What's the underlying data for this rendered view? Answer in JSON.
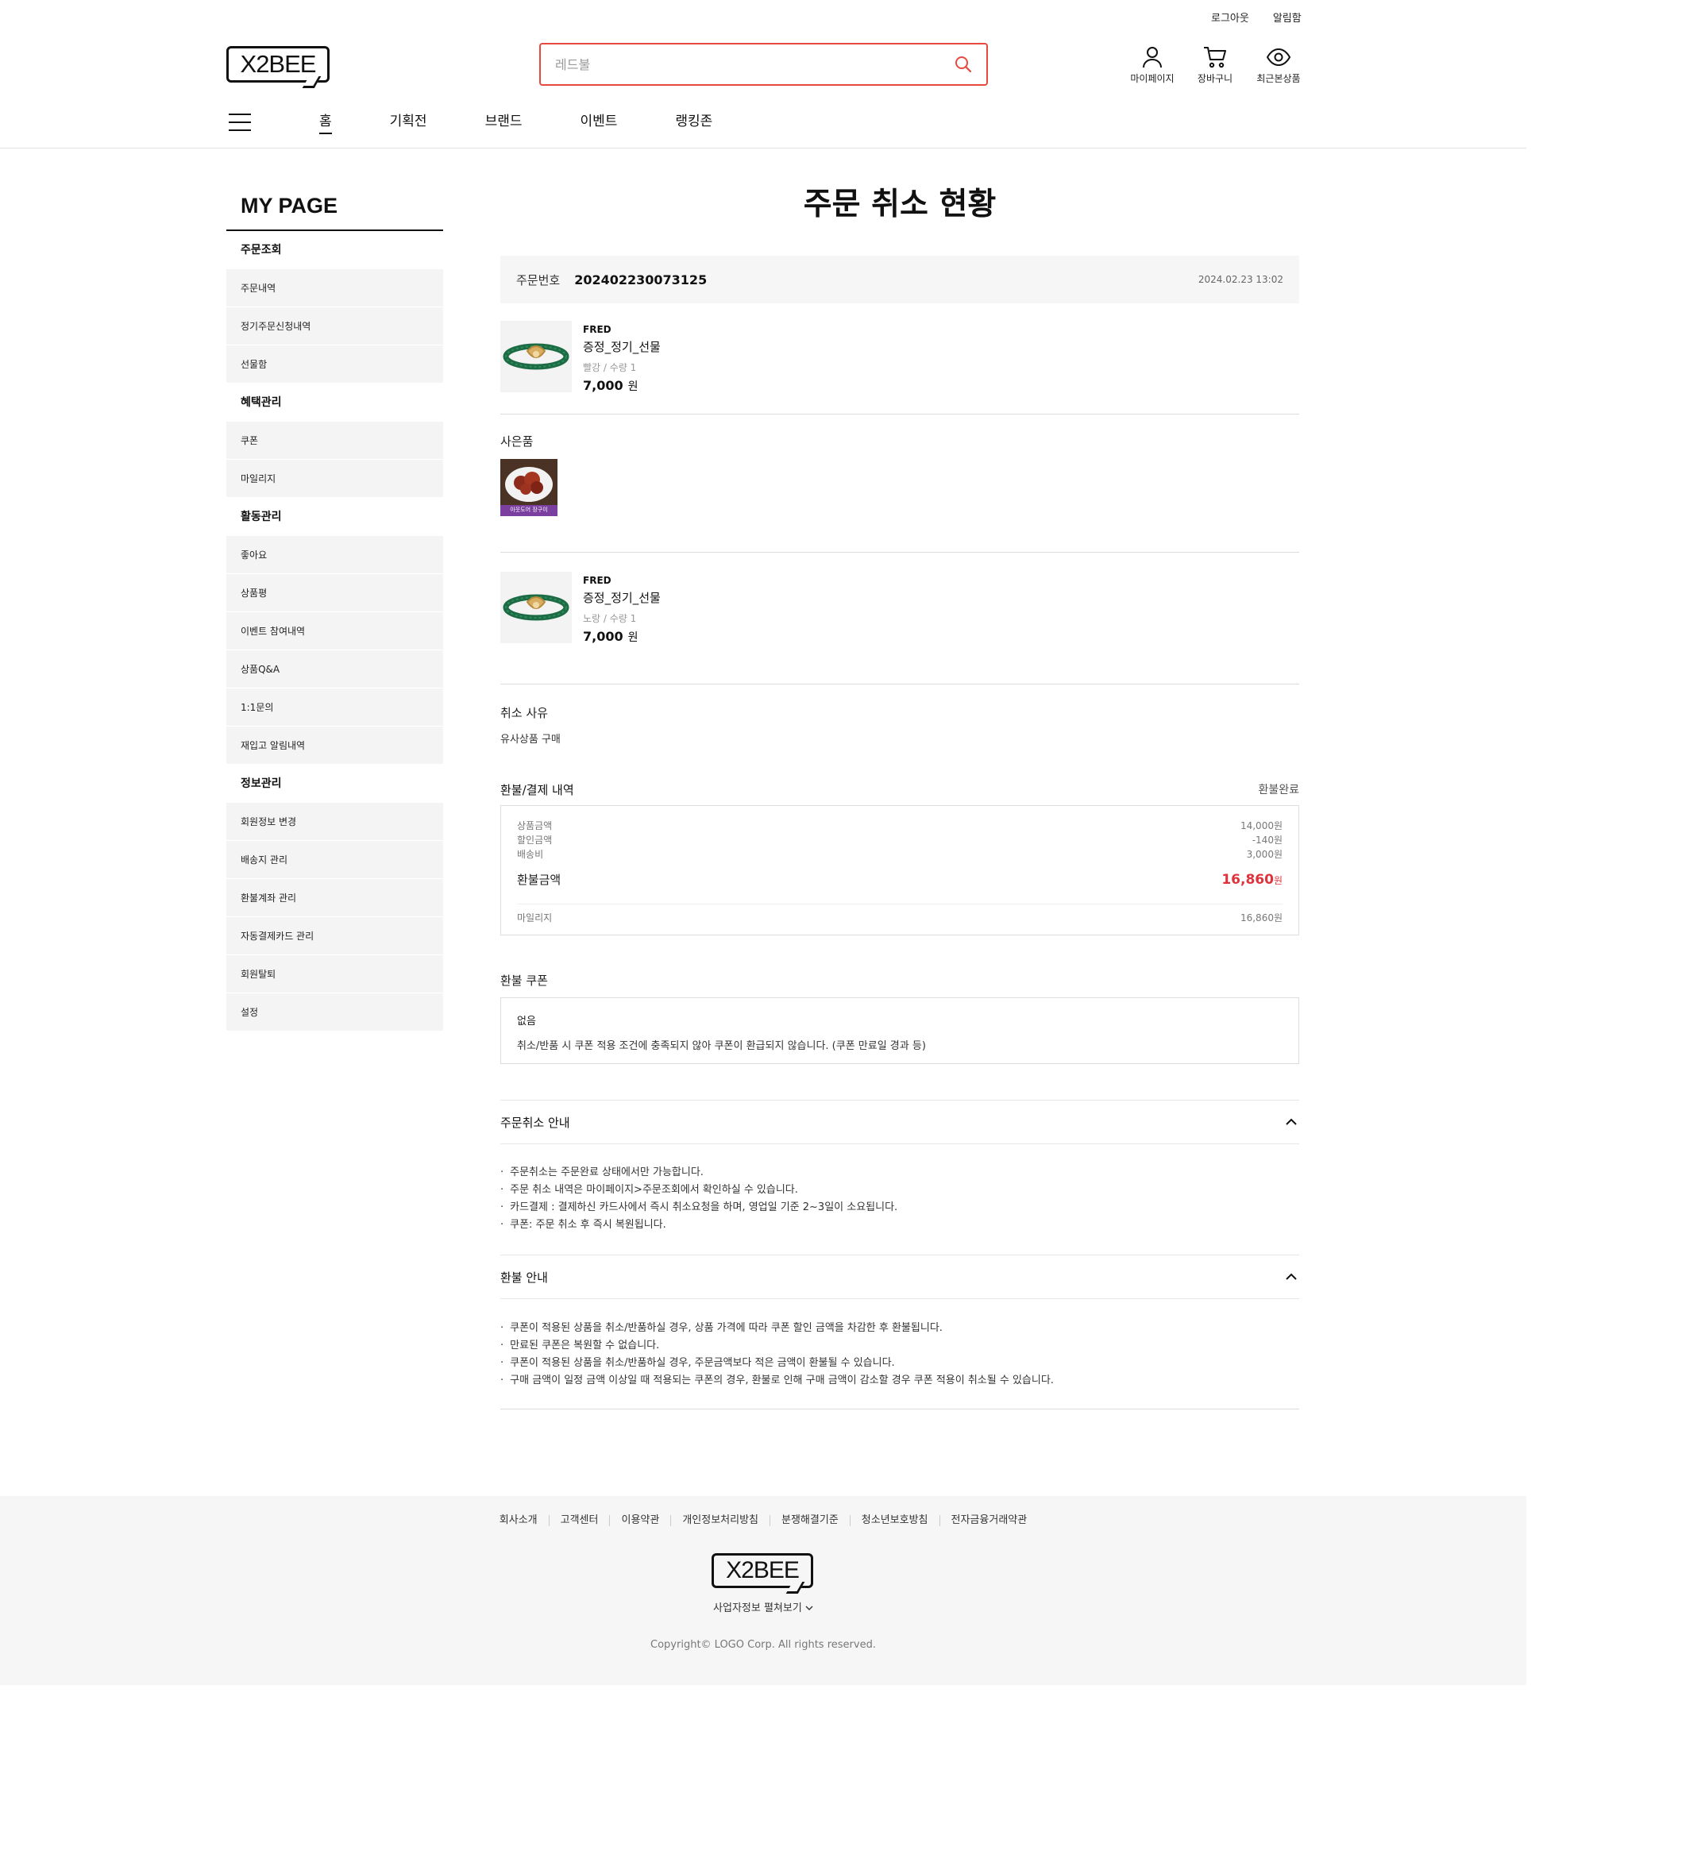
{
  "header": {
    "util": [
      "로그아웃",
      "알림함"
    ],
    "logo_text": "X2BEE",
    "search_placeholder": "레드불",
    "icons": [
      {
        "label": "마이페이지",
        "icon": "user-icon"
      },
      {
        "label": "장바구니",
        "icon": "cart-icon"
      },
      {
        "label": "최근본상품",
        "icon": "eye-icon"
      }
    ],
    "nav": [
      "홈",
      "기획전",
      "브랜드",
      "이벤트",
      "랭킹존"
    ]
  },
  "sidebar": {
    "title": "MY PAGE",
    "groups": [
      {
        "label": "주문조회",
        "items": [
          "주문내역",
          "정기주문신청내역",
          "선물함"
        ]
      },
      {
        "label": "혜택관리",
        "items": [
          "쿠폰",
          "마일리지"
        ]
      },
      {
        "label": "활동관리",
        "items": [
          "좋아요",
          "상품평",
          "이벤트 참여내역",
          "상품Q&A",
          "1:1문의",
          "재입고 알림내역"
        ]
      },
      {
        "label": "정보관리",
        "items": [
          "회원정보 변경",
          "배송지 관리",
          "환불계좌 관리",
          "자동결제카드 관리",
          "회원탈퇴",
          "설정"
        ]
      }
    ]
  },
  "main": {
    "title": "주문 취소 현황",
    "order": {
      "label": "주문번호",
      "number": "202402230073125",
      "date": "2024.02.23 13:02"
    },
    "products": [
      {
        "brand": "FRED",
        "name": "증정_정기_선물",
        "option": "빨강 / 수량 1",
        "price": "7,000",
        "unit": "원"
      },
      {
        "brand": "FRED",
        "name": "증정_정기_선물",
        "option": "노랑 / 수량 1",
        "price": "7,000",
        "unit": "원"
      }
    ],
    "gift_label": "사은품",
    "gift_caption": "아웃도어 장구이",
    "cancel_reason_label": "취소 사유",
    "cancel_reason": "유사상품 구매",
    "refund": {
      "label": "환불/결제 내역",
      "status": "환불완료",
      "rows": [
        {
          "label": "상품금액",
          "value": "14,000원"
        },
        {
          "label": "할인금액",
          "value": "-140원"
        },
        {
          "label": "배송비",
          "value": "3,000원"
        }
      ],
      "total_label": "환불금액",
      "total_value": "16,860",
      "total_unit": "원",
      "mileage_label": "마일리지",
      "mileage_value": "16,860원"
    },
    "coupon": {
      "label": "환불 쿠폰",
      "none": "없음",
      "desc": "취소/반품 시 쿠폰 적용 조건에 충족되지 않아 쿠폰이 환급되지 않습니다. (쿠폰 만료일 경과 등)"
    },
    "cancel_guide": {
      "title": "주문취소 안내",
      "items": [
        "주문취소는 주문완료 상태에서만 가능합니다.",
        "주문 취소 내역은 마이페이지>주문조회에서 확인하실 수 있습니다.",
        "카드결제 : 결제하신 카드사에서 즉시 취소요청을 하며, 영업일 기준 2~3일이 소요됩니다.",
        "쿠폰: 주문 취소 후 즉시 복원됩니다."
      ]
    },
    "refund_guide": {
      "title": "환불 안내",
      "items": [
        "쿠폰이 적용된 상품을 취소/반품하실 경우, 상품 가격에 따라 쿠폰 할인 금액을 차감한 후 환불됩니다.",
        "만료된 쿠폰은 복원할 수 없습니다.",
        "쿠폰이 적용된 상품을 취소/반품하실 경우, 주문금액보다 적은 금액이 환불될 수 있습니다.",
        "구매 금액이 일정 금액 이상일 때 적용되는 쿠폰의 경우, 환불로 인해 구매 금액이 감소할 경우 쿠폰 적용이 취소될 수 있습니다."
      ]
    }
  },
  "footer": {
    "links": [
      "회사소개",
      "고객센터",
      "이용약관",
      "개인정보처리방침",
      "분쟁해결기준",
      "청소년보호방침",
      "전자금융거래약관"
    ],
    "logo_text": "X2BEE",
    "biz_info": "사업자정보 펼쳐보기",
    "copyright": "Copyright© LOGO Corp. All rights reserved."
  },
  "colors": {
    "accent": "#e8493f",
    "price_red": "#e0323a",
    "sidebar_bg": "#f4f4f4"
  }
}
